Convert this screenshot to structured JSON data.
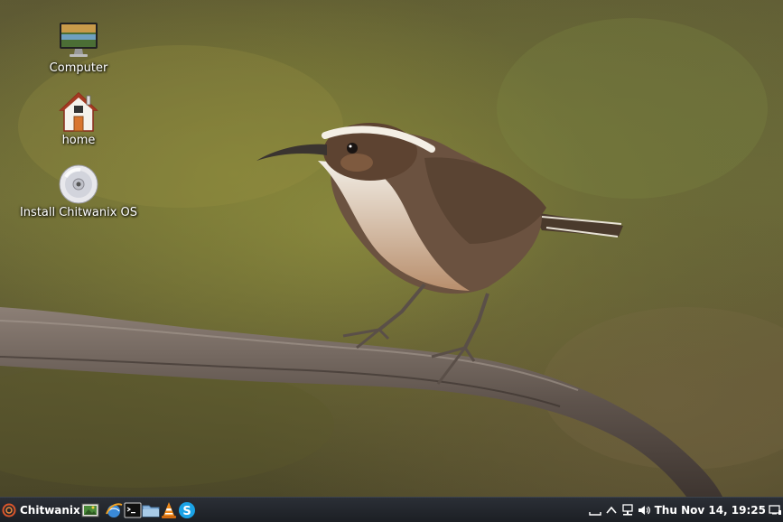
{
  "desktop": {
    "wallpaper_subject": "bird perched on branch",
    "icons": [
      {
        "label": "Computer",
        "icon": "computer-monitor-icon"
      },
      {
        "label": "home",
        "icon": "home-house-icon"
      },
      {
        "label": "Install Chitwanix OS",
        "icon": "disc-cd-icon"
      }
    ]
  },
  "taskbar": {
    "start_label": "Chitwanix",
    "launchers": [
      {
        "icon": "image-viewer-icon"
      },
      {
        "icon": "web-browser-icon"
      },
      {
        "icon": "terminal-icon"
      },
      {
        "icon": "file-manager-folder-icon"
      },
      {
        "icon": "vlc-media-player-icon"
      },
      {
        "icon": "skype-icon"
      }
    ],
    "tray": {
      "icons": [
        "keyboard-layout-icon",
        "show-hidden-chevron-icon",
        "network-icon",
        "volume-icon"
      ],
      "clock": "Thu Nov 14, 19:25",
      "show_desktop_icon": "show-desktop-icon"
    }
  },
  "colors": {
    "taskbar_bg": "#1f2228",
    "label_text": "#ffffff"
  }
}
